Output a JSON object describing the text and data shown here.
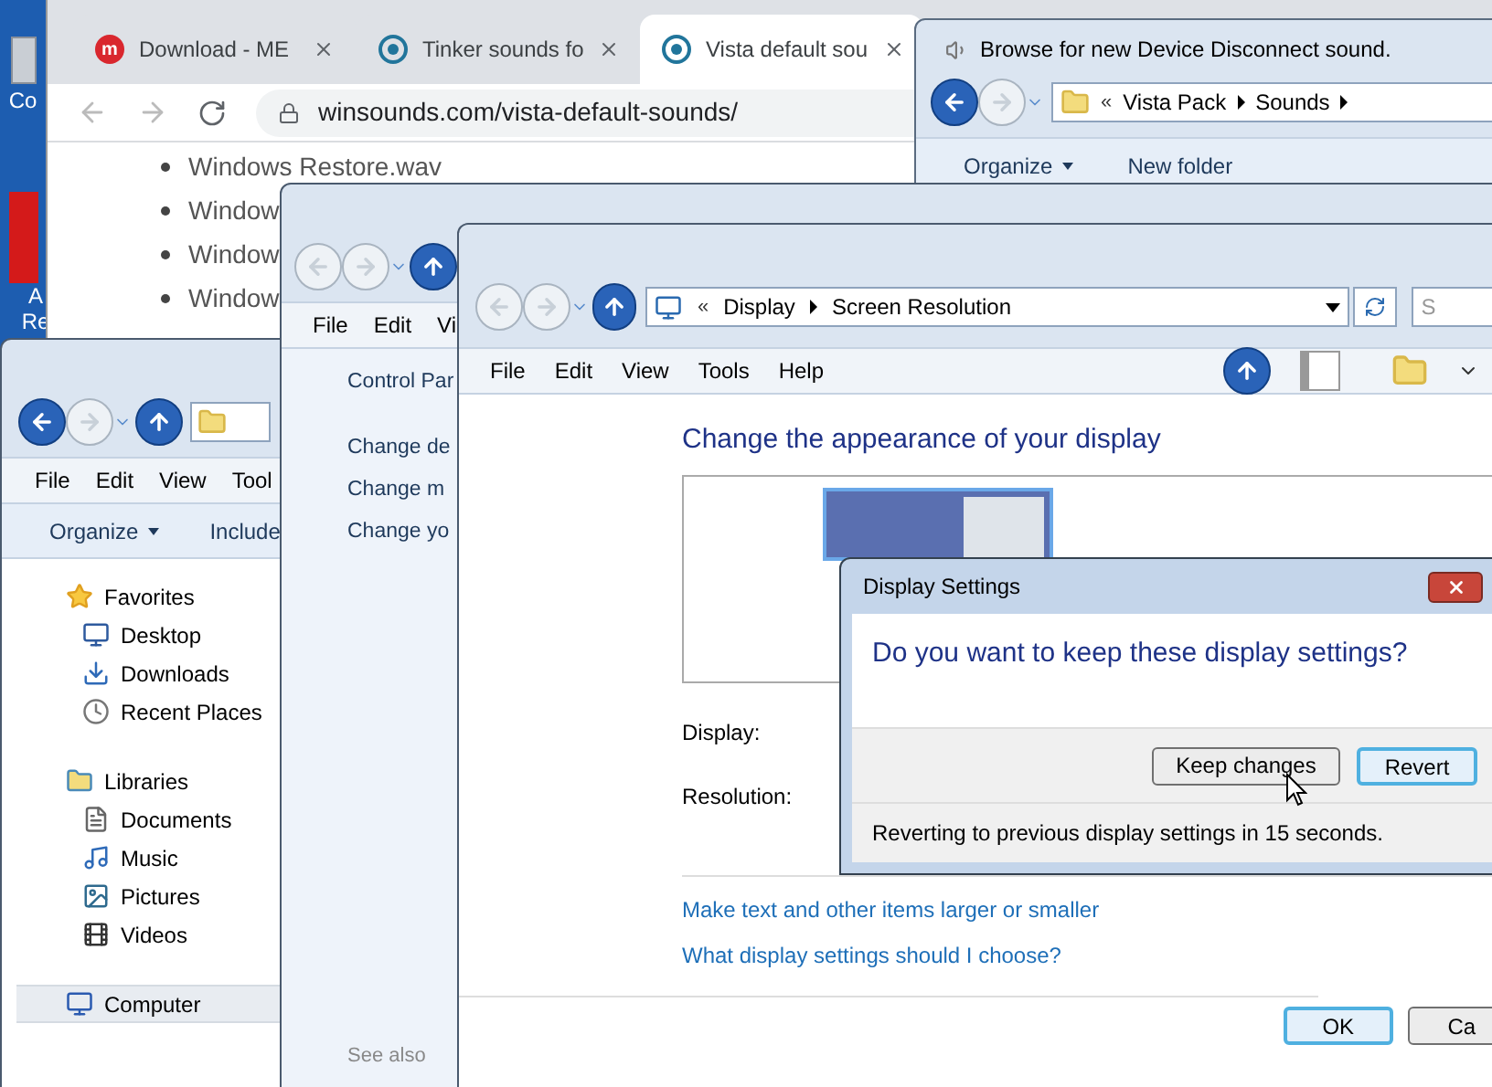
{
  "desktop": {
    "icons": [
      {
        "label_lines": [
          "Co"
        ]
      },
      {
        "label_lines": [
          "A",
          "Re"
        ]
      }
    ]
  },
  "browser": {
    "tabs": [
      {
        "title": "Download - ME",
        "selected": false,
        "kind": "mega",
        "logo_letter": "m"
      },
      {
        "title": "Tinker sounds fo",
        "selected": false,
        "kind": "wordpress"
      },
      {
        "title": "Vista default sou",
        "selected": true,
        "kind": "wordpress"
      }
    ],
    "url": "winsounds.com/vista-default-sounds/",
    "list_items": [
      "Windows Restore.wav",
      "Window",
      "Window",
      "Window"
    ]
  },
  "browse_dialog": {
    "title": "Browse for new Device Disconnect sound.",
    "breadcrumb_prefix": "«",
    "breadcrumb": [
      "Vista Pack",
      "Sounds"
    ],
    "toolbar": [
      "Organize",
      "New folder"
    ]
  },
  "explorer": {
    "menu": [
      "File",
      "Edit",
      "View",
      "Tool"
    ],
    "toolbar": [
      "Organize",
      "Include"
    ],
    "tree": [
      {
        "label": "Favorites",
        "kind": "star",
        "selected": false,
        "children": [
          {
            "label": "Desktop",
            "kind": "desktop",
            "selected": false
          },
          {
            "label": "Downloads",
            "kind": "download",
            "selected": false
          },
          {
            "label": "Recent Places",
            "kind": "recent",
            "selected": false
          }
        ]
      },
      {
        "label": "Libraries",
        "kind": "library",
        "selected": false,
        "children": [
          {
            "label": "Documents",
            "kind": "document",
            "selected": false
          },
          {
            "label": "Music",
            "kind": "music",
            "selected": false
          },
          {
            "label": "Pictures",
            "kind": "pictures",
            "selected": false
          },
          {
            "label": "Videos",
            "kind": "videos",
            "selected": false
          }
        ]
      },
      {
        "label": "Computer",
        "kind": "computer",
        "selected": true
      }
    ]
  },
  "control_panel": {
    "menu": [
      "File",
      "Edit",
      "Vi"
    ],
    "home": "Control Par",
    "tasks": [
      "Change de",
      "Change m",
      "Change yo"
    ],
    "see_also": "See also"
  },
  "display_window": {
    "breadcrumb_prefix": "«",
    "breadcrumb": [
      "Display",
      "Screen Resolution"
    ],
    "search_placeholder": "S",
    "menu": [
      "File",
      "Edit",
      "View",
      "Tools",
      "Help"
    ],
    "heading": "Change the appearance of your display",
    "labels": [
      "Display:",
      "Resolution:"
    ],
    "links": [
      "Make text and other items larger or smaller",
      "What display settings should I choose?"
    ],
    "buttons": [
      {
        "label": "OK",
        "default": true
      },
      {
        "label": "Ca",
        "default": false
      }
    ]
  },
  "dialog": {
    "title": "Display Settings",
    "question": "Do you want to keep these display settings?",
    "buttons": [
      {
        "label": "Keep changes",
        "default": false
      },
      {
        "label": "Revert",
        "default": true
      }
    ],
    "countdown": "Reverting to previous display settings in 15 seconds."
  }
}
